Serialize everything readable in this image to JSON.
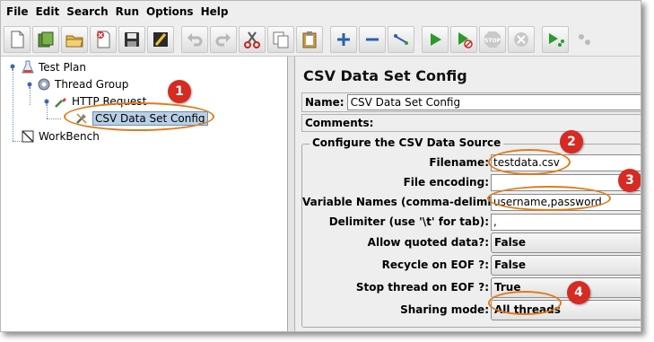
{
  "menubar": {
    "items": [
      "File",
      "Edit",
      "Search",
      "Run",
      "Options",
      "Help"
    ]
  },
  "toolbar": {
    "buttons": [
      "new-icon",
      "templates-icon",
      "open-icon",
      "close-icon",
      "save-icon",
      "save-screenshot-icon",
      "undo-icon",
      "redo-icon",
      "cut-icon",
      "copy-icon",
      "paste-icon",
      "expand-icon",
      "collapse-icon",
      "toggle-icon",
      "start-icon",
      "start-no-pause-icon",
      "stop-icon",
      "shutdown-icon",
      "remote-start-icon",
      "remote-icon"
    ]
  },
  "tree": {
    "nodes": [
      {
        "label": "Test Plan"
      },
      {
        "label": "Thread Group"
      },
      {
        "label": "HTTP Request"
      },
      {
        "label": "CSV Data Set Config"
      },
      {
        "label": "WorkBench"
      }
    ]
  },
  "panel": {
    "title": "CSV Data Set Config",
    "name_label": "Name:",
    "name_value": "CSV Data Set Config",
    "comments_label": "Comments:",
    "group_title": "Configure the CSV Data Source",
    "fields": [
      {
        "label": "Filename:",
        "value": "testdata.csv"
      },
      {
        "label": "File encoding:",
        "value": ""
      },
      {
        "label": "Variable Names (comma-delimited):",
        "value": "username,password"
      },
      {
        "label": "Delimiter (use '\\t' for tab):",
        "value": ","
      },
      {
        "label": "Allow quoted data?:",
        "value": "False"
      },
      {
        "label": "Recycle on EOF ?:",
        "value": "False"
      },
      {
        "label": "Stop thread on EOF ?:",
        "value": "True"
      },
      {
        "label": "Sharing mode:",
        "value": "All threads"
      }
    ]
  },
  "callouts": [
    "1",
    "2",
    "3",
    "4"
  ],
  "colors": {
    "callout_badge": "#d72a23",
    "callout_ring": "#e07b1c",
    "selection": "#b8cfe5"
  }
}
